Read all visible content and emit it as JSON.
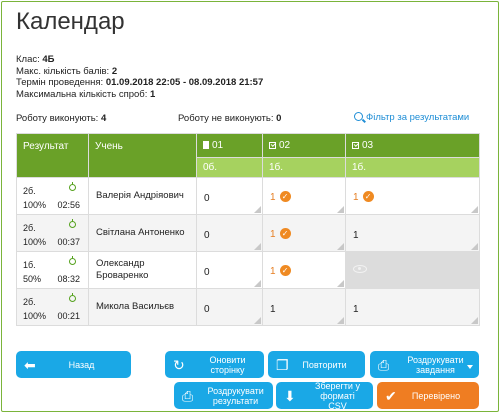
{
  "title": "Календар",
  "info": {
    "class_label": "Клас:",
    "class_value": "4Б",
    "max_label": "Макс. кількість балів:",
    "max_value": "2",
    "term_label": "Термін проведення:",
    "term_value": "01.09.2018 22:05 - 08.09.2018 21:57",
    "attempts_label": "Максимальна кількість спроб:",
    "attempts_value": "1"
  },
  "summary": {
    "doing_label": "Роботу виконують:",
    "doing_value": "4",
    "not_doing_label": "Роботу не виконують:",
    "not_doing_value": "0",
    "filter_label": "Фільтр за результатами"
  },
  "table": {
    "col_result": "Результат",
    "col_student": "Учень",
    "tasks": [
      {
        "label": "01",
        "max": "0б.",
        "icon": "page-icon"
      },
      {
        "label": "02",
        "max": "1б.",
        "icon": "checkbox-icon"
      },
      {
        "label": "03",
        "max": "1б.",
        "icon": "checkbox-icon"
      }
    ],
    "rows": [
      {
        "score": "2б.",
        "percent": "100%",
        "time": "02:56",
        "name": "Валерія Андріяович",
        "s1": "0",
        "s2": "1",
        "s3": "1"
      },
      {
        "score": "2б.",
        "percent": "100%",
        "time": "00:37",
        "name": "Світлана Антоненко",
        "s1": "0",
        "s2": "1",
        "s3": "1"
      },
      {
        "score": "1б.",
        "percent": "50%",
        "time": "08:32",
        "name": "Олександр Броваренко",
        "s1": "0",
        "s2": "1",
        "s3": ""
      },
      {
        "score": "2б.",
        "percent": "100%",
        "time": "00:21",
        "name": "Микола Васильєв",
        "s1": "0",
        "s2": "1",
        "s3": "1"
      }
    ]
  },
  "buttons": {
    "back": "Назад",
    "refresh": "Оновити сторінку",
    "repeat": "Повторити",
    "print_tasks": "Роздрукувати завдання",
    "print_results": "Роздрукувати результати",
    "save_csv": "Зберегти у форматі CSV",
    "checked": "Перевірено"
  },
  "colors": {
    "header_green": "#6aa128",
    "subheader_green": "#a6d25f",
    "button_blue": "#1aa8e6",
    "button_orange": "#ef7d22",
    "check_orange": "#ef8a22"
  }
}
